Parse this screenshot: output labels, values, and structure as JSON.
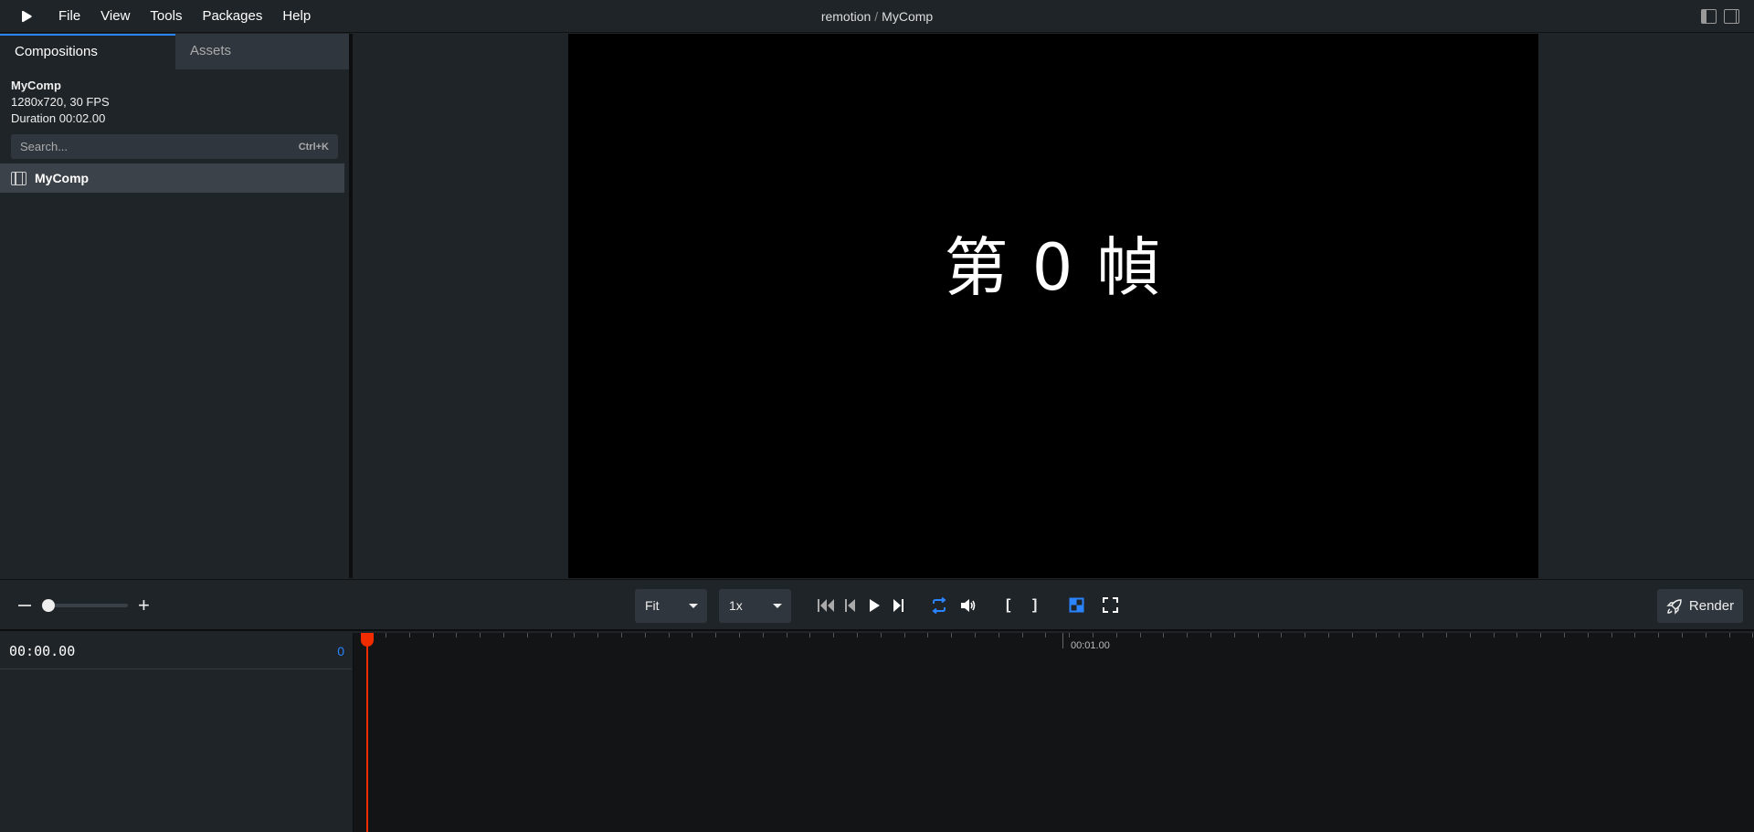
{
  "menubar": {
    "items": [
      "File",
      "View",
      "Tools",
      "Packages",
      "Help"
    ],
    "title_project": "remotion",
    "title_separator": "/",
    "title_comp": "MyComp"
  },
  "sidebar": {
    "tabs": [
      {
        "label": "Compositions",
        "active": true
      },
      {
        "label": "Assets",
        "active": false
      }
    ],
    "comp_name": "MyComp",
    "comp_dims": "1280x720, 30 FPS",
    "comp_duration": "Duration 00:02.00",
    "search_placeholder": "Search...",
    "search_shortcut": "Ctrl+K",
    "compositions": [
      {
        "label": "MyComp",
        "selected": true
      }
    ]
  },
  "preview": {
    "frame_text": "第 0 幀"
  },
  "controls": {
    "size_select": "Fit",
    "rate_select": "1x",
    "loop_active": true,
    "checkerboard_active": true,
    "render_label": "Render"
  },
  "timeline": {
    "timecode": "00:00.00",
    "frame": "0",
    "ruler_label": "00:01.00"
  },
  "colors": {
    "accent": "#2a84ff",
    "playhead": "#f02c00",
    "panel": "#1f2428",
    "input": "#2f363d"
  }
}
